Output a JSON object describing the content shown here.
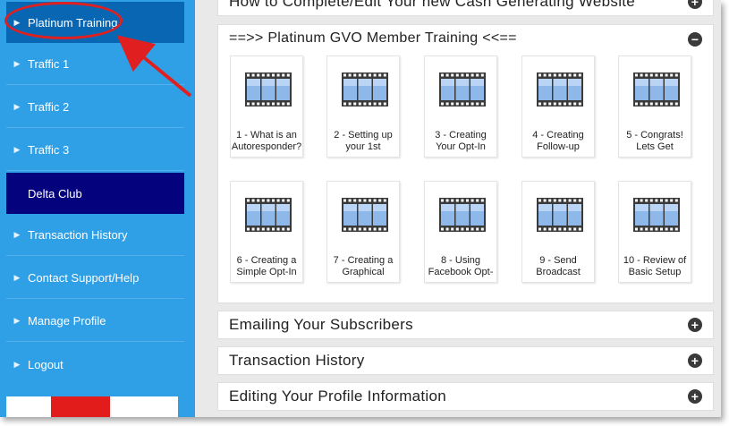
{
  "sidebar": {
    "items": [
      {
        "label": "Platinum Training"
      },
      {
        "label": "Traffic 1"
      },
      {
        "label": "Traffic 2"
      },
      {
        "label": "Traffic 3"
      },
      {
        "label": "Delta Club"
      },
      {
        "label": "Transaction History"
      },
      {
        "label": "Contact Support/Help"
      },
      {
        "label": "Manage Profile"
      },
      {
        "label": "Logout"
      }
    ]
  },
  "main": {
    "top_section": "How to Complete/Edit Your new Cash Generating Website",
    "panel_title": "==>> Platinum GVO Member Training <<==",
    "videos": [
      {
        "line1": "1 - What is an",
        "line2": "Autoresponder?"
      },
      {
        "line1": "2 - Setting up",
        "line2": "your 1st"
      },
      {
        "line1": "3 - Creating",
        "line2": "Your Opt-In"
      },
      {
        "line1": "4 - Creating",
        "line2": "Follow-up"
      },
      {
        "line1": "5 - Congrats!",
        "line2": "Lets Get"
      },
      {
        "line1": "6 - Creating a",
        "line2": "Simple Opt-In"
      },
      {
        "line1": "7 - Creating a",
        "line2": "Graphical"
      },
      {
        "line1": "8 - Using",
        "line2": "Facebook Opt-"
      },
      {
        "line1": "9 - Send",
        "line2": "Broadcast"
      },
      {
        "line1": "10 - Review of",
        "line2": "Basic Setup"
      }
    ],
    "sections": [
      {
        "label": "Emailing Your Subscribers"
      },
      {
        "label": "Transaction History"
      },
      {
        "label": "Editing Your Profile Information"
      }
    ]
  },
  "colors": {
    "sidebar_bg": "#2f9fe6",
    "active_item": "#0866b3",
    "delta_club": "#05027d",
    "annotation": "#e02020"
  }
}
